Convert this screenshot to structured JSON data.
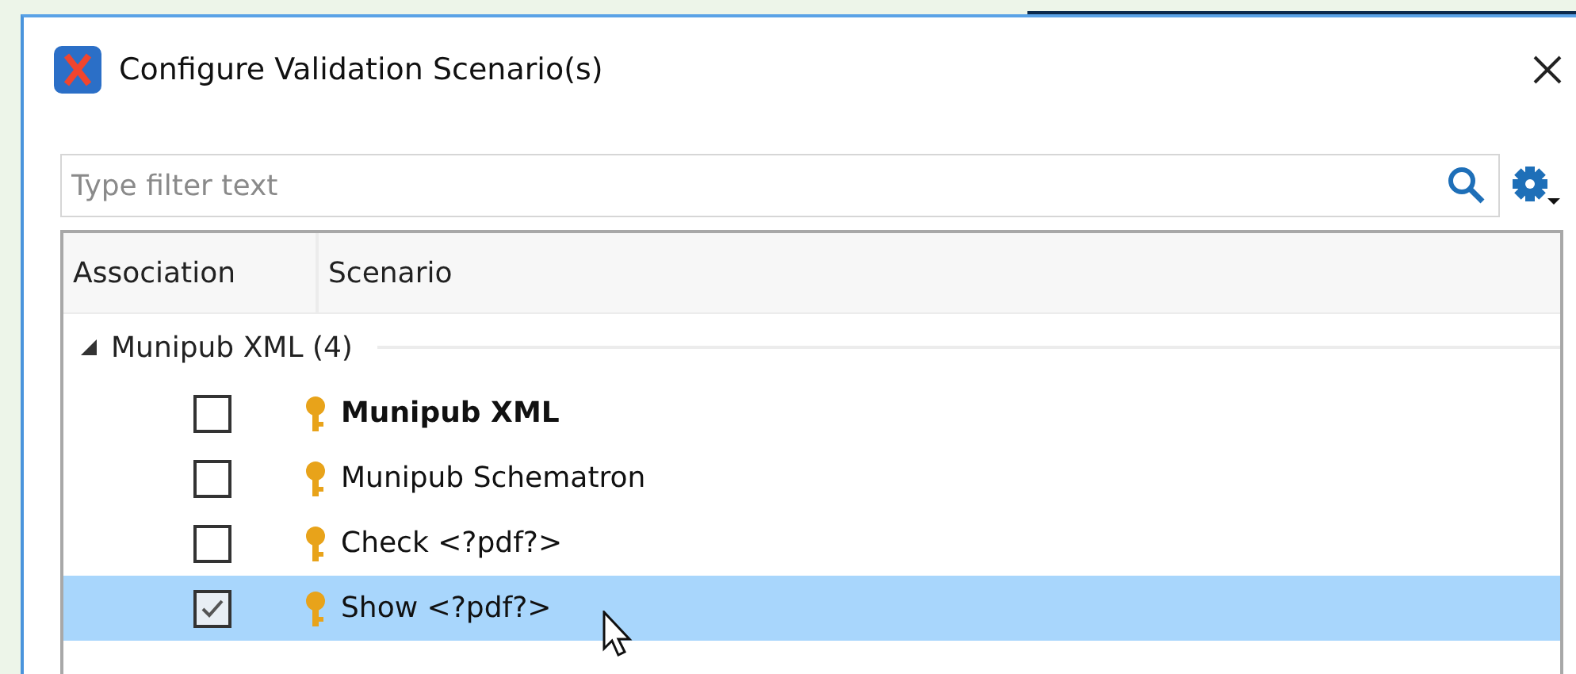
{
  "window": {
    "title": "Configure Validation Scenario(s)"
  },
  "filter": {
    "placeholder": "Type filter text"
  },
  "table": {
    "columns": [
      "Association",
      "Scenario"
    ],
    "groups": [
      {
        "label": "Munipub XML (4)",
        "expanded": true,
        "rows": [
          {
            "scenario": "Munipub XML",
            "bold": true,
            "checked": false,
            "selected": false
          },
          {
            "scenario": "Munipub Schematron",
            "bold": false,
            "checked": false,
            "selected": false
          },
          {
            "scenario": "Check <?pdf?>",
            "bold": false,
            "checked": false,
            "selected": false
          },
          {
            "scenario": "Show <?pdf?>",
            "bold": false,
            "checked": true,
            "selected": true
          }
        ]
      }
    ]
  }
}
